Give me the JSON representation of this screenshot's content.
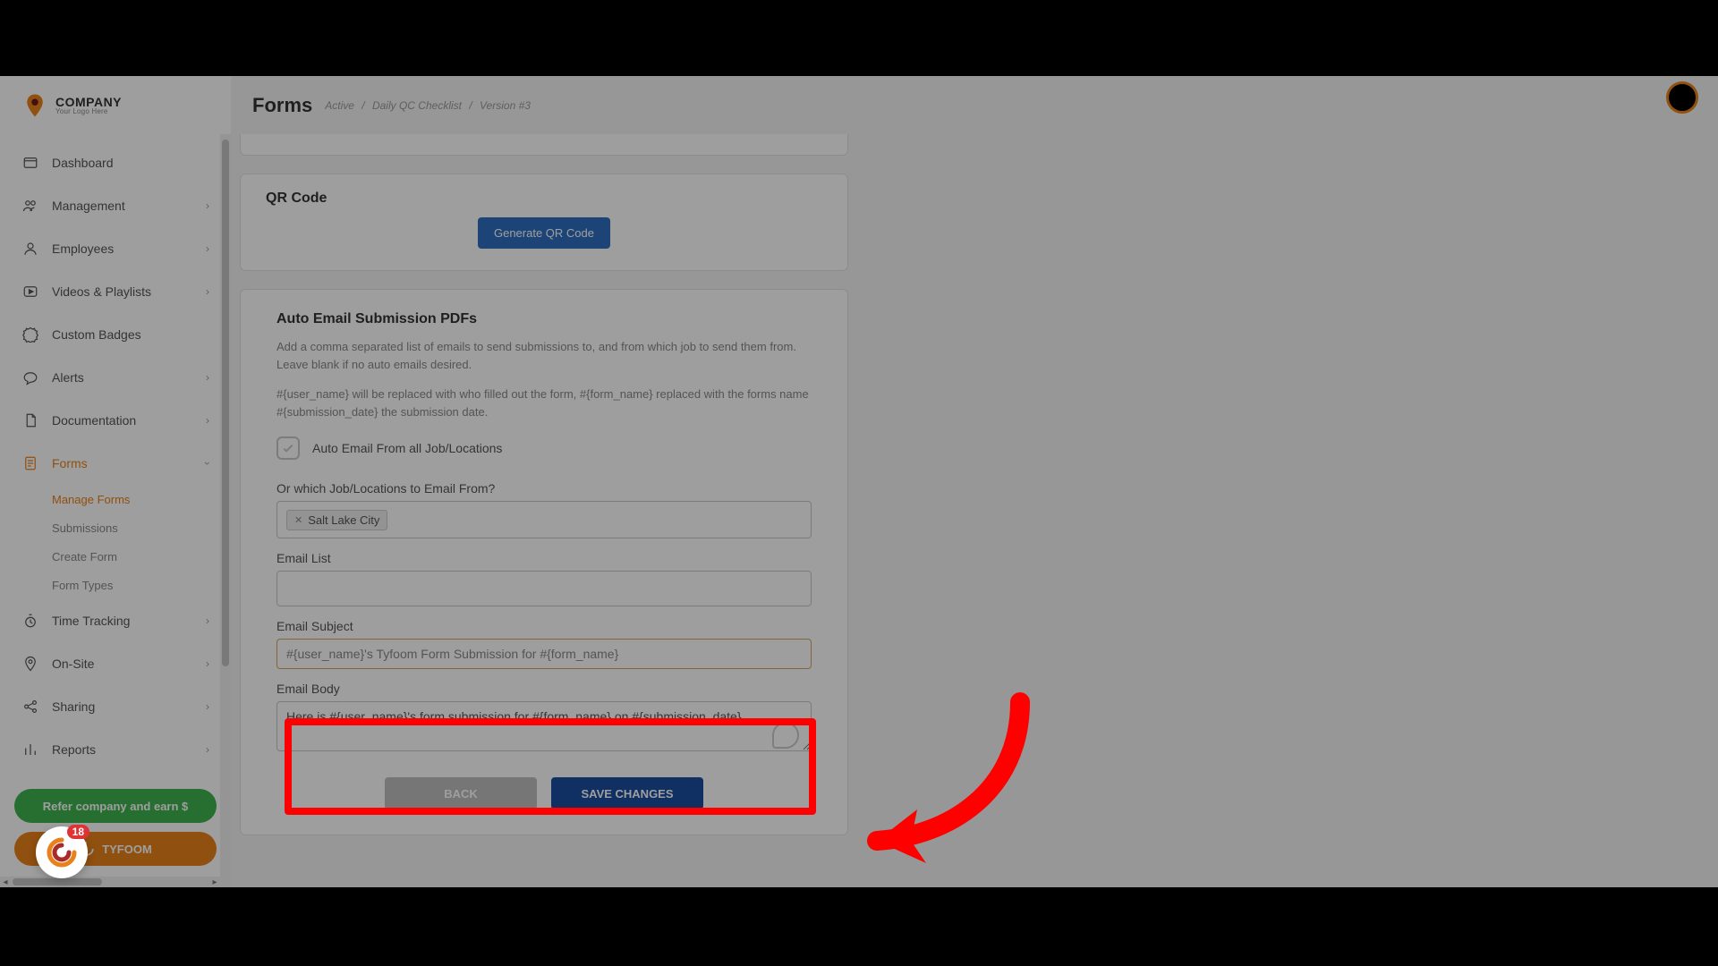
{
  "logo": {
    "main": "COMPANY",
    "sub": "Your Logo Here"
  },
  "nav": {
    "dashboard": "Dashboard",
    "management": "Management",
    "employees": "Employees",
    "videos": "Videos & Playlists",
    "badges": "Custom Badges",
    "alerts": "Alerts",
    "documentation": "Documentation",
    "forms": "Forms",
    "forms_sub": {
      "manage": "Manage Forms",
      "submissions": "Submissions",
      "create": "Create Form",
      "types": "Form Types"
    },
    "time": "Time Tracking",
    "onsite": "On-Site",
    "sharing": "Sharing",
    "reports": "Reports"
  },
  "pills": {
    "refer": "Refer company and earn $",
    "tyfoom": "TYFOOM"
  },
  "intercom": {
    "count": "18"
  },
  "header": {
    "title": "Forms",
    "crumbs": {
      "a": "Active",
      "b": "Daily QC Checklist",
      "c": "Version #3"
    }
  },
  "qr": {
    "title": "QR Code",
    "button": "Generate QR Code"
  },
  "auto": {
    "title": "Auto Email Submission PDFs",
    "desc1": "Add a comma separated list of emails to send submissions to, and from which job to send them from. Leave blank if no auto emails desired.",
    "desc2": "#{user_name} will be replaced with who filled out the form, #{form_name} replaced with the forms name #{submission_date} the submission date.",
    "checkbox_label": "Auto Email From all Job/Locations",
    "loc_label": "Or which Job/Locations to Email From?",
    "loc_tag": "Salt Lake City",
    "email_list_label": "Email List",
    "subject_label": "Email Subject",
    "subject_value": "#{user_name}'s Tyfoom Form Submission for #{form_name}",
    "body_label": "Email Body",
    "body_value": "Here is #{user_name}'s form submission for #{form_name} on #{submission_date}"
  },
  "buttons": {
    "back": "BACK",
    "save": "SAVE CHANGES"
  }
}
